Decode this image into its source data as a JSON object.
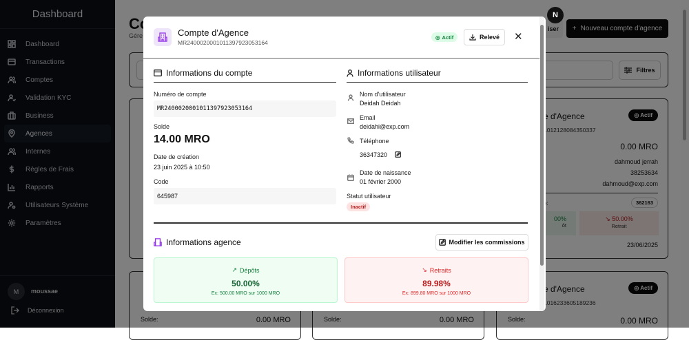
{
  "sidebar": {
    "title": "Dashboard",
    "items": [
      {
        "label": "Dashboard",
        "icon": "grid-icon"
      },
      {
        "label": "Transactions",
        "icon": "credit-card-icon"
      },
      {
        "label": "Comptes",
        "icon": "users-icon"
      },
      {
        "label": "Validation KYC",
        "icon": "user-check-icon"
      },
      {
        "label": "Business",
        "icon": "briefcase-icon"
      },
      {
        "label": "Agences",
        "icon": "map-pin-icon",
        "active": true
      },
      {
        "label": "Internes",
        "icon": "users-icon"
      },
      {
        "label": "Règles de Frais",
        "icon": "dollar-icon"
      },
      {
        "label": "Rapports",
        "icon": "bar-chart-icon"
      },
      {
        "label": "Utilisateurs Système",
        "icon": "user-cog-icon"
      },
      {
        "label": "Paramètres",
        "icon": "gear-icon"
      }
    ],
    "user": {
      "initial": "M",
      "name": "moussae"
    },
    "logout": "Déconnexion"
  },
  "header": {
    "title": "Co",
    "subtitle": "Gére",
    "reset_label": "iser",
    "new_label": "Nouveau compte d'agence",
    "user_initial": "N",
    "filters_label": "Filtres"
  },
  "cards": [
    {
      "title": "e d'Agence",
      "account": "1012128084350337",
      "status": "Actif",
      "balance": "0.00 MRO",
      "user": "dahmoud jerrah",
      "phone": "38253634",
      "email": "dahmoud@exp.com",
      "code_label": "e:",
      "code": "362163",
      "deposit": "00%",
      "deposit_label": "ôt",
      "withdraw": "50.00%",
      "withdraw_label": "Retrait",
      "date": "23/06/2025"
    },
    {
      "title": "e d'Agence",
      "account": "1016233605189236",
      "status": "Actif",
      "balance": "0.00 MRO"
    }
  ],
  "bottom_row": {
    "solde_label": "Solde:",
    "balance": "0.00 MRO"
  },
  "modal": {
    "title": "Compte d'Agence",
    "subtitle": "MR2400020001011397923053164",
    "status": "Actif",
    "releve_label": "Relevé",
    "account_section": {
      "heading": "Informations du compte",
      "account_label": "Numéro de compte",
      "account": "MR2400020001011397923053164",
      "balance_label": "Solde",
      "balance": "14.00 MRO",
      "created_label": "Date de création",
      "created": "23 juin 2025 à 10:50",
      "code_label": "Code",
      "code": "645987"
    },
    "user_section": {
      "heading": "Informations utilisateur",
      "name_label": "Nom d'utilisateur",
      "name": "Deidah Deidah",
      "email_label": "Email",
      "email": "deidahi@exp.com",
      "phone_label": "Téléphone",
      "phone": "36347320",
      "birth_label": "Date de naissance",
      "birth": "01 février 2000",
      "status_label": "Statut utilisateur",
      "status": "Inactif"
    },
    "agency_section": {
      "heading": "Informations agence",
      "edit_label": "Modifier les commissions",
      "deposits": {
        "label": "Dépôts",
        "percent": "50.00%",
        "example": "Ex: 500.00 MRO sur 1000 MRO",
        "color": "#15803d"
      },
      "withdrawals": {
        "label": "Retraits",
        "percent": "89.98%",
        "example": "Ex: 899.80 MRO sur 1000 MRO",
        "color": "#b91c1c"
      }
    }
  }
}
